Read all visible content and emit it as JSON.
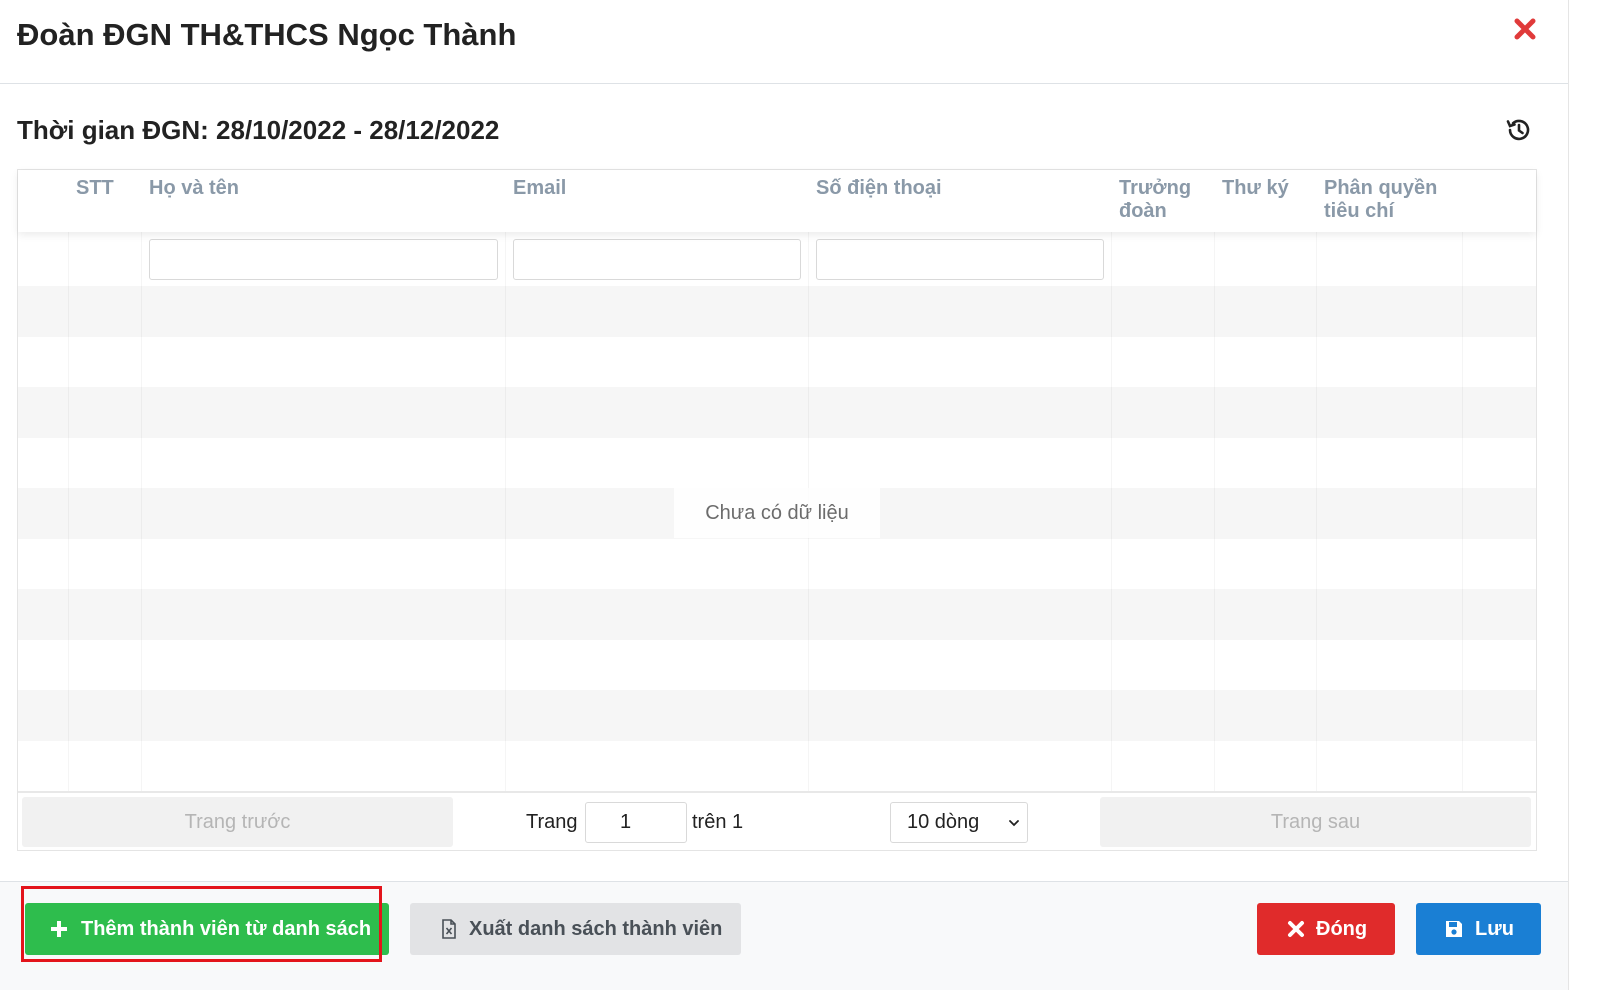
{
  "modal": {
    "title": "Đoàn ĐGN TH&THCS Ngọc Thành",
    "period": "Thời gian ĐGN: 28/10/2022 - 28/12/2022"
  },
  "icons": {
    "close": "close-icon",
    "history": "history-icon",
    "plus": "plus-icon",
    "excel": "excel-file-icon",
    "times": "times-icon",
    "save": "floppy-disk-icon",
    "chevron": "chevron-down-icon"
  },
  "table": {
    "headers": {
      "stt": "STT",
      "name": "Họ và tên",
      "email": "Email",
      "phone": "Số điện thoại",
      "leader_1": "Trưởng",
      "leader_2": "đoàn",
      "secretary": "Thư ký",
      "criteria_1": "Phân quyền",
      "criteria_2": "tiêu chí"
    },
    "filters": {
      "name": "",
      "email": "",
      "phone": ""
    },
    "empty_text": "Chưa có dữ liệu"
  },
  "pagination": {
    "prev": "Trang trước",
    "page_label": "Trang",
    "page_value": "1",
    "of_label": "trên 1",
    "page_size": "10 dòng",
    "next": "Trang sau"
  },
  "footer": {
    "add": "Thêm thành viên từ danh sách",
    "export": "Xuất danh sách thành viên",
    "close": "Đóng",
    "save": "Lưu"
  },
  "colors": {
    "add": "#2ebd4d",
    "export": "#e2e3e5",
    "close": "#e02b2b",
    "save": "#1a7fd4",
    "highlight": "#e3141b"
  }
}
